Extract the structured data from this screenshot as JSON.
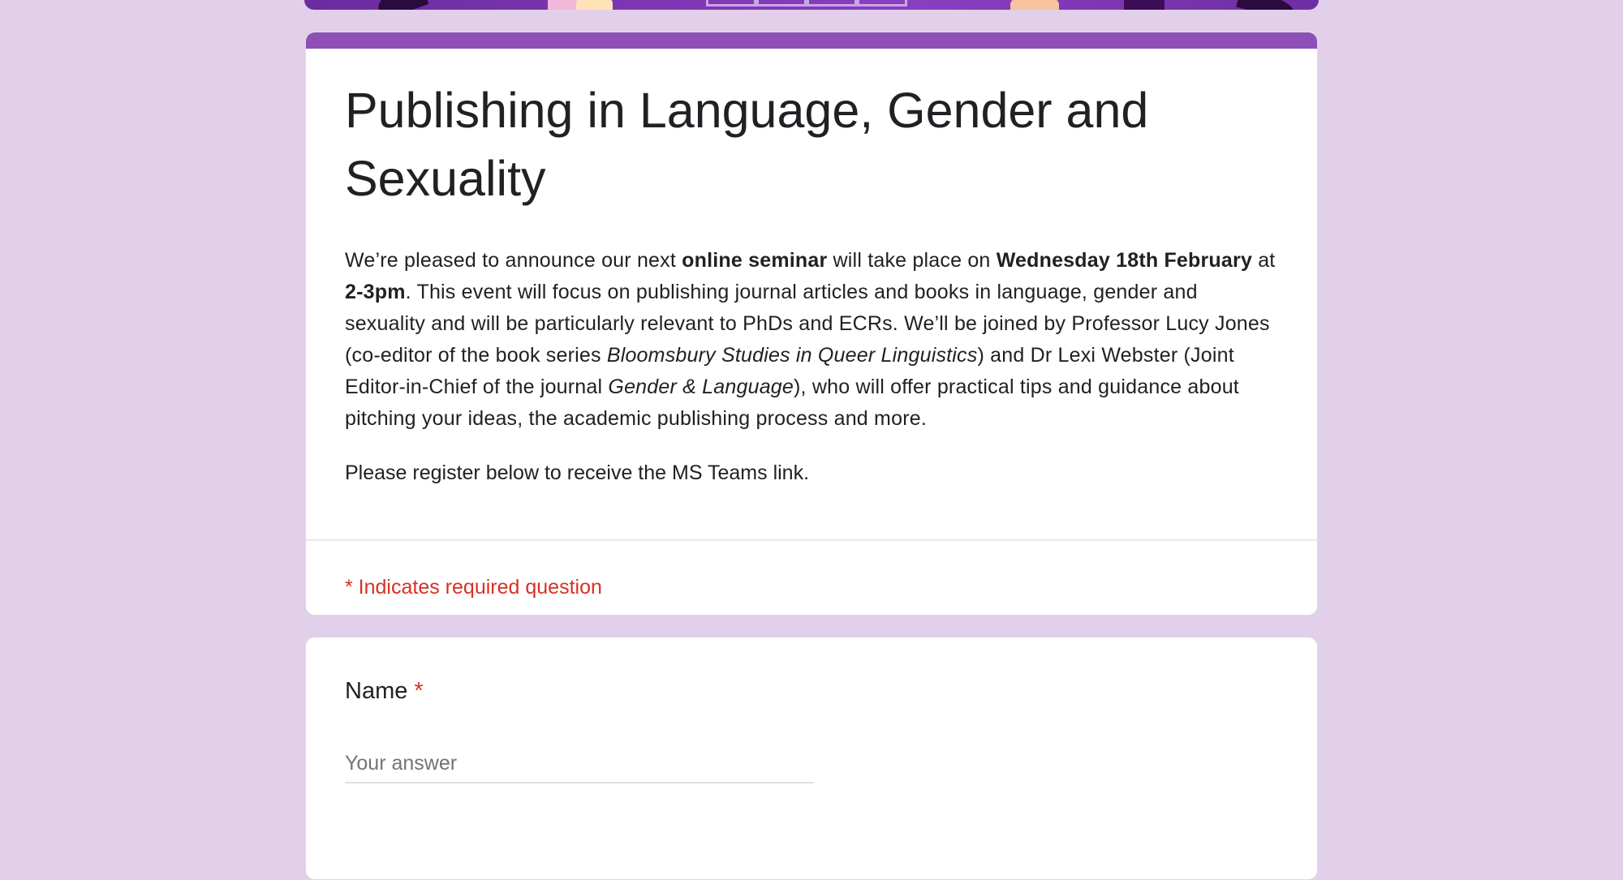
{
  "form": {
    "title": "Publishing in Language, Gender and Sexuality",
    "description": {
      "p1": "We’re pleased to announce our next ",
      "b1": "online seminar",
      "p2": " will take place on ",
      "b2": "Wednesday 18th February",
      "p3": " at ",
      "b3": "2-3pm",
      "p4": ". This event will focus on publishing journal articles and books in language, gender and sexuality and will be particularly relevant to PhDs and ECRs. We’ll be joined by Professor Lucy Jones (co-editor of the book series ",
      "i1": "Bloomsbury Studies in Queer Linguistics",
      "p5": ") and Dr Lexi Webster (Joint Editor-in-Chief of the journal ",
      "i2": "Gender & Language",
      "p6": "), who will offer practical tips and guidance about pitching your ideas, the academic publishing process and more."
    },
    "register_text": "Please register below to receive the MS Teams link.",
    "required_note": "* Indicates required question"
  },
  "questions": [
    {
      "label": "Name",
      "required_mark": "*",
      "placeholder": "Your answer"
    }
  ],
  "colors": {
    "background": "#e2cfe9",
    "accent": "#8e4fb6",
    "required": "#d93025"
  }
}
